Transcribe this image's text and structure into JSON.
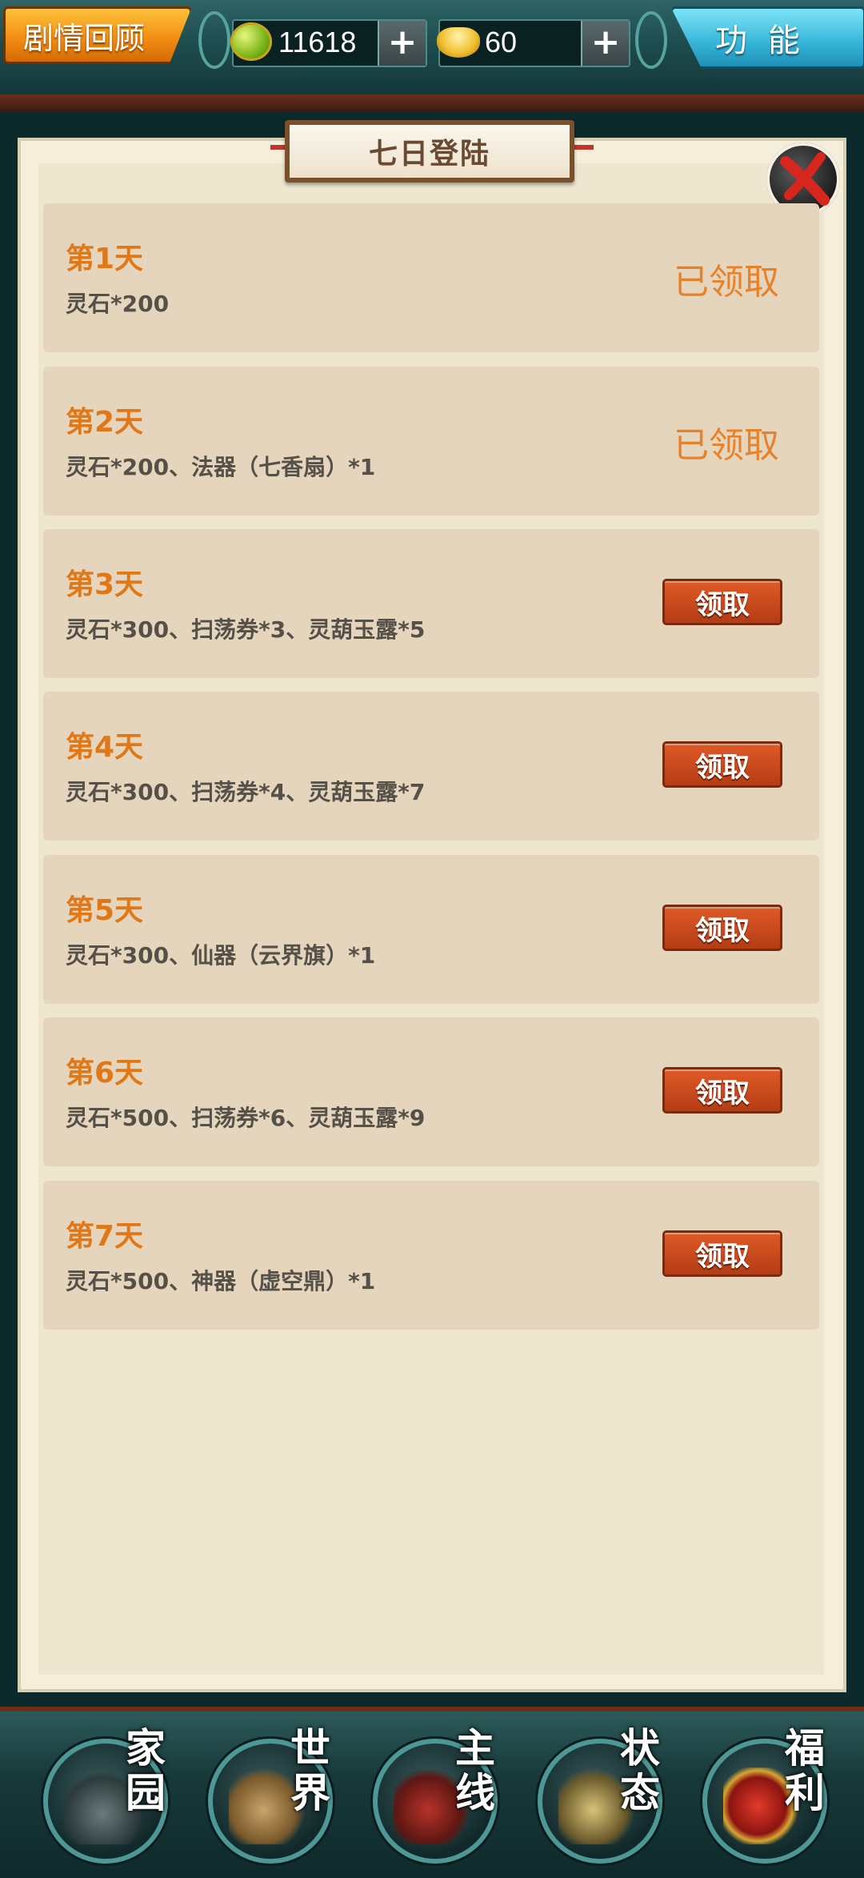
{
  "top_bar": {
    "story_button": "剧情回顾",
    "spirit_stone_value": "11618",
    "gold_value": "60",
    "plus_label": "+",
    "function_button": "功能"
  },
  "panel": {
    "title": "七日登陆",
    "rows": [
      {
        "day": "第1天",
        "reward": "灵石*200",
        "status": "已领取",
        "claimed": true
      },
      {
        "day": "第2天",
        "reward": "灵石*200、法器（七香扇）*1",
        "status": "已领取",
        "claimed": true
      },
      {
        "day": "第3天",
        "reward": "灵石*300、扫荡券*3、灵葫玉露*5",
        "status": "领取",
        "claimed": false
      },
      {
        "day": "第4天",
        "reward": "灵石*300、扫荡券*4、灵葫玉露*7",
        "status": "领取",
        "claimed": false
      },
      {
        "day": "第5天",
        "reward": "灵石*300、仙器（云界旗）*1",
        "status": "领取",
        "claimed": false
      },
      {
        "day": "第6天",
        "reward": "灵石*500、扫荡券*6、灵葫玉露*9",
        "status": "领取",
        "claimed": false
      },
      {
        "day": "第7天",
        "reward": "灵石*500、神器（虚空鼎）*1",
        "status": "领取",
        "claimed": false
      }
    ]
  },
  "bottom_nav": [
    {
      "label": "家园",
      "icon": "home-icon"
    },
    {
      "label": "世界",
      "icon": "world-map-icon"
    },
    {
      "label": "主线",
      "icon": "main-quest-icon"
    },
    {
      "label": "状态",
      "icon": "status-scroll-icon"
    },
    {
      "label": "福利",
      "icon": "welfare-bag-icon"
    }
  ],
  "colors": {
    "accent_orange": "#e07818",
    "claim_button": "#c9491c",
    "row_background": "#e6d5bd",
    "panel_background": "#efe6cf"
  }
}
